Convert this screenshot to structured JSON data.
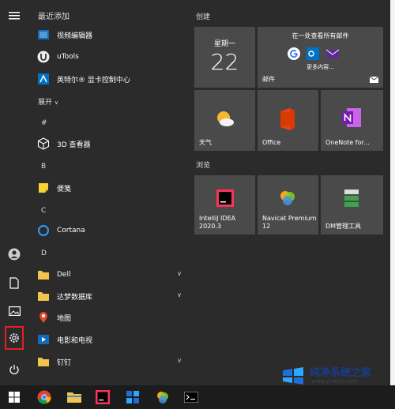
{
  "rail": {
    "icons": [
      "hamburger-menu-icon",
      "user-icon",
      "document-icon",
      "pictures-icon",
      "settings-icon",
      "power-icon"
    ]
  },
  "apps": {
    "recent_header": "最近添加",
    "recent": [
      {
        "label": "视频编辑器",
        "icon": "video-editor-icon"
      },
      {
        "label": "uTools",
        "icon": "utools-icon"
      },
      {
        "label": "英特尔® 显卡控制中心",
        "icon": "intel-graphics-icon"
      }
    ],
    "expand": "展开",
    "groups": [
      {
        "letter": "#",
        "items": [
          {
            "label": "3D 查看器",
            "icon": "3d-viewer-icon"
          }
        ]
      },
      {
        "letter": "B",
        "items": [
          {
            "label": "便笺",
            "icon": "sticky-notes-icon"
          }
        ]
      },
      {
        "letter": "C",
        "items": [
          {
            "label": "Cortana",
            "icon": "cortana-icon"
          }
        ]
      },
      {
        "letter": "D",
        "items": [
          {
            "label": "Dell",
            "icon": "folder-icon",
            "expandable": true
          },
          {
            "label": "达梦数据库",
            "icon": "folder-icon",
            "expandable": true
          },
          {
            "label": "地图",
            "icon": "maps-icon"
          },
          {
            "label": "电影和电视",
            "icon": "movies-tv-icon"
          },
          {
            "label": "钉钉",
            "icon": "folder-icon",
            "expandable": true
          }
        ]
      }
    ]
  },
  "tiles": {
    "group1": "创建",
    "calendar": {
      "day": "星期一",
      "date": "22"
    },
    "mail": {
      "line1": "在一处查看所有邮件",
      "more": "更多内容...",
      "label": "邮件"
    },
    "weather": "天气",
    "office": "Office",
    "onenote": "OneNote for...",
    "group2": "浏览",
    "idea": "IntelliJ IDEA 2020.3",
    "navicat": "Navicat Premium 12",
    "dm": "DM管理工具"
  },
  "watermark": {
    "title": "纯净系统之家",
    "url": "www.ycwjzy.com"
  },
  "taskbar": {
    "icons": [
      "windows-start-icon",
      "chrome-icon",
      "file-explorer-icon",
      "intellij-icon",
      "app-grid-icon",
      "navicat-icon",
      "terminal-icon"
    ]
  },
  "colors": {
    "accent": "#0078d7",
    "highlight": "#e52020"
  }
}
